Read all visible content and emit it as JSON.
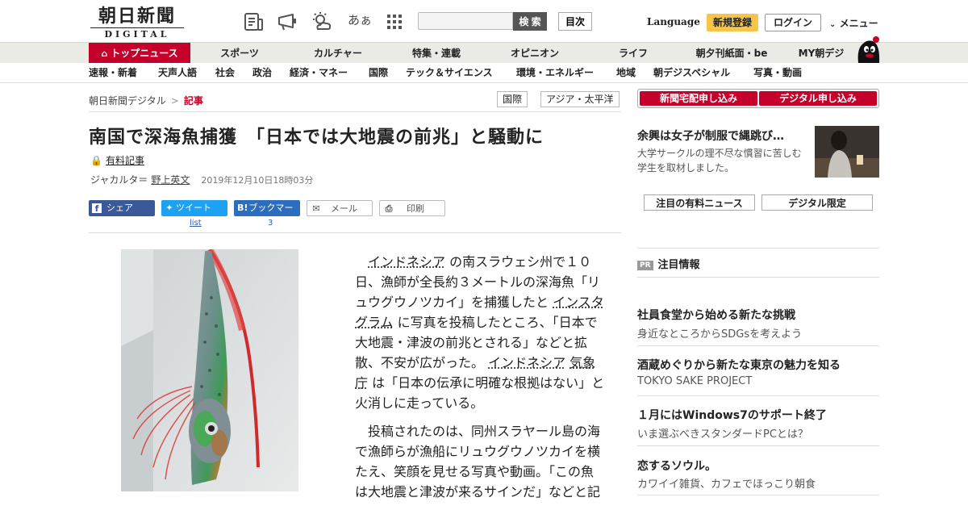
{
  "header": {
    "logo_line1": "朝日新聞",
    "logo_line2": "DIGITAL",
    "search_placeholder": "",
    "search_button": "検 索",
    "toc_button": "目次",
    "language": "Language",
    "register": "新規登録",
    "login": "ログイン",
    "menu": "メニュー",
    "font_size_icon_text": "あぁ"
  },
  "nav_main": [
    "トップニュース",
    "スポーツ",
    "カルチャー",
    "特集・連載",
    "オピニオン",
    "ライフ",
    "朝夕刊紙面・be",
    "MY朝デジ"
  ],
  "nav_sub": [
    "速報・新着",
    "天声人語",
    "社会",
    "政治",
    "経済・マネー",
    "国際",
    "テック＆サイエンス",
    "環境・エネルギー",
    "地域",
    "朝デジスペシャル",
    "写真・動画"
  ],
  "breadcrumb": {
    "root": "朝日新聞デジタル",
    "sep": ">",
    "current": "記事"
  },
  "tags": [
    "国際",
    "アジア・太平洋"
  ],
  "article": {
    "title": "南国で深海魚捕獲　「日本では大地震の前兆」と騒動に",
    "paid_label": "有料記事",
    "location": "ジャカルタ＝",
    "author": "野上英文",
    "date": "2019年12月10日18時03分",
    "p1_link1": "インドネシア",
    "p1_a": "の南スラウェシ州で１０日、漁師が全長約３メートルの深海魚「リュウグウノツカイ」を捕獲したと",
    "p1_link2": "インスタグラム",
    "p1_b": "に写真を投稿したところ、「日本で大地震・津波の前兆とされる」などと拡散、不安が広がった。",
    "p1_link3": "インドネシア",
    "p1_link4": "気象庁",
    "p1_c": "は「日本の伝承に明確な根拠はない」と火消しに走っている。",
    "p2": "投稿されたのは、同州スラヤール島の海で漁師らが漁船にリュウグウノツカイを横たえ、笑顔を見せる写真や動画。「この魚は大地震と津波が来るサインだ」などと記"
  },
  "share": {
    "share": "シェア",
    "tweet": "ツイート",
    "tweet_count": "list",
    "bookmark": "ブックマーク",
    "bookmark_count": "3",
    "mail": "メール",
    "print": "印刷"
  },
  "sidebar": {
    "order_paper": "新聞宅配申し込み",
    "order_digital": "デジタル申し込み",
    "featured_title": "余興は女子が制服で縄跳び…",
    "featured_desc": "大学サークルの理不尽な慣習に苦しむ学生を取材しました。",
    "btn_paid_news": "注目の有料ニュース",
    "btn_digital": "デジタル限定",
    "pr_badge": "PR",
    "pr_heading": "注目情報",
    "pr_items": [
      {
        "title": "社員食堂から始める新たな挑戦",
        "sub": "身近なところからSDGsを考えよう"
      },
      {
        "title": "酒蔵めぐりから新たな東京の魅力を知る",
        "sub": "TOKYO SAKE PROJECT"
      },
      {
        "title": "１月にはWindows7のサポート終了",
        "sub": "いま選ぶべきスタンダードPCとは？"
      },
      {
        "title": "恋するソウル。",
        "sub": "カワイイ雑貨、カフェでほっこり朝食"
      }
    ]
  },
  "colors": {
    "brand_red": "#c5002a",
    "facebook": "#3b5998",
    "twitter": "#1da1f2",
    "hatena": "#2c6ebd",
    "register_yellow": "#f7c54a"
  }
}
